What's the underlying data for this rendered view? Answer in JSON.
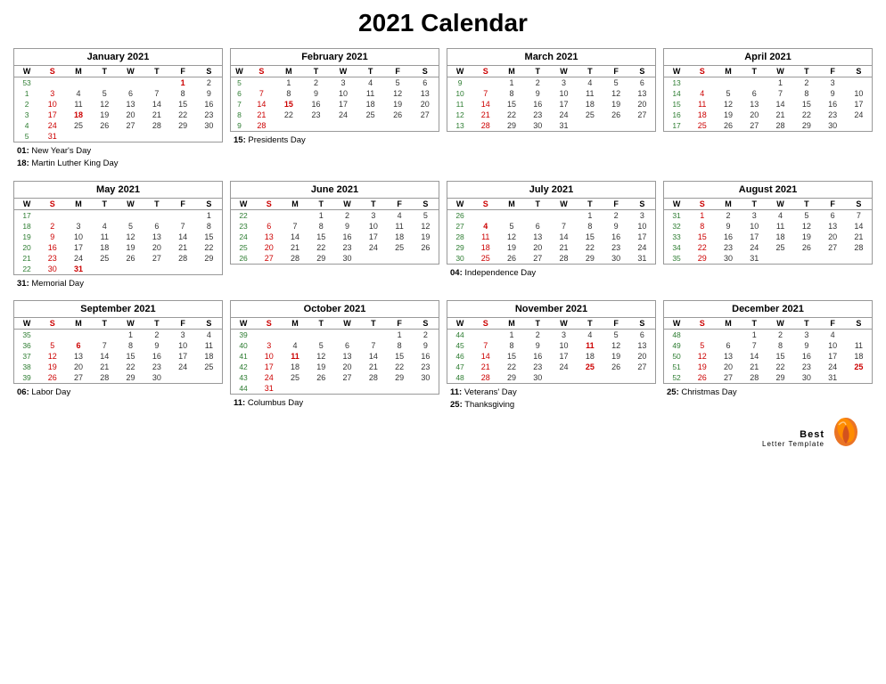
{
  "title": "2021 Calendar",
  "months": [
    {
      "name": "January 2021",
      "headers": [
        "W",
        "S",
        "M",
        "T",
        "W",
        "T",
        "F",
        "S"
      ],
      "rows": [
        [
          "53",
          "",
          "",
          "",
          "",
          "",
          "1",
          "2"
        ],
        [
          "1",
          "3",
          "4",
          "5",
          "6",
          "7",
          "8",
          "9"
        ],
        [
          "2",
          "10",
          "11",
          "12",
          "13",
          "14",
          "15",
          "16"
        ],
        [
          "3",
          "17",
          "18",
          "19",
          "20",
          "21",
          "22",
          "23"
        ],
        [
          "4",
          "24",
          "25",
          "26",
          "27",
          "28",
          "29",
          "30"
        ],
        [
          "5",
          "31",
          "",
          "",
          "",
          "",
          "",
          ""
        ]
      ],
      "holidays_text": "01: New Year's Day\n18: Martin Luther King Day",
      "holidays": [
        {
          "day": "01",
          "name": "New Year's Day"
        },
        {
          "day": "18",
          "name": "Martin Luther King Day"
        }
      ],
      "holiday_days": [
        "1"
      ],
      "holiday_style_days": {
        "1": "holiday",
        "18": "holiday"
      }
    },
    {
      "name": "February 2021",
      "headers": [
        "W",
        "S",
        "M",
        "T",
        "W",
        "T",
        "F",
        "S"
      ],
      "rows": [
        [
          "5",
          "",
          "1",
          "2",
          "3",
          "4",
          "5",
          "6"
        ],
        [
          "6",
          "7",
          "8",
          "9",
          "10",
          "11",
          "12",
          "13"
        ],
        [
          "7",
          "14",
          "15",
          "16",
          "17",
          "18",
          "19",
          "20"
        ],
        [
          "8",
          "21",
          "22",
          "23",
          "24",
          "25",
          "26",
          "27"
        ],
        [
          "9",
          "28",
          "",
          "",
          "",
          "",
          "",
          ""
        ]
      ],
      "holidays": [
        {
          "day": "15",
          "name": "Presidents Day"
        }
      ]
    },
    {
      "name": "March 2021",
      "headers": [
        "W",
        "S",
        "M",
        "T",
        "W",
        "T",
        "F",
        "S"
      ],
      "rows": [
        [
          "9",
          "",
          "1",
          "2",
          "3",
          "4",
          "5",
          "6"
        ],
        [
          "10",
          "7",
          "8",
          "9",
          "10",
          "11",
          "12",
          "13"
        ],
        [
          "11",
          "14",
          "15",
          "16",
          "17",
          "18",
          "19",
          "20"
        ],
        [
          "12",
          "21",
          "22",
          "23",
          "24",
          "25",
          "26",
          "27"
        ],
        [
          "13",
          "28",
          "29",
          "30",
          "31",
          "",
          "",
          ""
        ]
      ],
      "holidays": []
    },
    {
      "name": "April 2021",
      "headers": [
        "W",
        "S",
        "M",
        "T",
        "W",
        "T",
        "F",
        "S"
      ],
      "rows": [
        [
          "13",
          "",
          "",
          "",
          "1",
          "2",
          "3"
        ],
        [
          "14",
          "4",
          "5",
          "6",
          "7",
          "8",
          "9",
          "10"
        ],
        [
          "15",
          "11",
          "12",
          "13",
          "14",
          "15",
          "16",
          "17"
        ],
        [
          "16",
          "18",
          "19",
          "20",
          "21",
          "22",
          "23",
          "24"
        ],
        [
          "17",
          "25",
          "26",
          "27",
          "28",
          "29",
          "30",
          ""
        ]
      ],
      "holidays": []
    },
    {
      "name": "May 2021",
      "headers": [
        "W",
        "S",
        "M",
        "T",
        "W",
        "T",
        "F",
        "S"
      ],
      "rows": [
        [
          "17",
          "",
          "",
          "",
          "",
          "",
          "",
          "1"
        ],
        [
          "18",
          "2",
          "3",
          "4",
          "5",
          "6",
          "7",
          "8"
        ],
        [
          "19",
          "9",
          "10",
          "11",
          "12",
          "13",
          "14",
          "15"
        ],
        [
          "20",
          "16",
          "17",
          "18",
          "19",
          "20",
          "21",
          "22"
        ],
        [
          "21",
          "23",
          "24",
          "25",
          "26",
          "27",
          "28",
          "29"
        ],
        [
          "22",
          "30",
          "31",
          "",
          "",
          "",
          "",
          ""
        ]
      ],
      "holidays": [
        {
          "day": "31",
          "name": "Memorial Day"
        }
      ]
    },
    {
      "name": "June 2021",
      "headers": [
        "W",
        "S",
        "M",
        "T",
        "W",
        "T",
        "F",
        "S"
      ],
      "rows": [
        [
          "22",
          "",
          "",
          "1",
          "2",
          "3",
          "4",
          "5"
        ],
        [
          "23",
          "6",
          "7",
          "8",
          "9",
          "10",
          "11",
          "12"
        ],
        [
          "24",
          "13",
          "14",
          "15",
          "16",
          "17",
          "18",
          "19"
        ],
        [
          "25",
          "20",
          "21",
          "22",
          "23",
          "24",
          "25",
          "26"
        ],
        [
          "26",
          "27",
          "28",
          "29",
          "30",
          "",
          "",
          ""
        ]
      ],
      "holidays": []
    },
    {
      "name": "July 2021",
      "headers": [
        "W",
        "S",
        "M",
        "T",
        "W",
        "T",
        "F",
        "S"
      ],
      "rows": [
        [
          "26",
          "",
          "",
          "",
          "",
          "1",
          "2",
          "3"
        ],
        [
          "27",
          "4",
          "5",
          "6",
          "7",
          "8",
          "9",
          "10"
        ],
        [
          "28",
          "11",
          "12",
          "13",
          "14",
          "15",
          "16",
          "17"
        ],
        [
          "29",
          "18",
          "19",
          "20",
          "21",
          "22",
          "23",
          "24"
        ],
        [
          "30",
          "25",
          "26",
          "27",
          "28",
          "29",
          "30",
          "31"
        ]
      ],
      "holidays": [
        {
          "day": "04",
          "name": "Independence Day"
        }
      ]
    },
    {
      "name": "August 2021",
      "headers": [
        "W",
        "S",
        "M",
        "T",
        "W",
        "T",
        "F",
        "S"
      ],
      "rows": [
        [
          "31",
          "1",
          "2",
          "3",
          "4",
          "5",
          "6",
          "7"
        ],
        [
          "32",
          "8",
          "9",
          "10",
          "11",
          "12",
          "13",
          "14"
        ],
        [
          "33",
          "15",
          "16",
          "17",
          "18",
          "19",
          "20",
          "21"
        ],
        [
          "34",
          "22",
          "23",
          "24",
          "25",
          "26",
          "27",
          "28"
        ],
        [
          "35",
          "29",
          "30",
          "31",
          "",
          "",
          "",
          ""
        ]
      ],
      "holidays": []
    },
    {
      "name": "September 2021",
      "headers": [
        "W",
        "S",
        "M",
        "T",
        "W",
        "T",
        "F",
        "S"
      ],
      "rows": [
        [
          "35",
          "",
          "",
          "",
          "1",
          "2",
          "3",
          "4"
        ],
        [
          "36",
          "5",
          "6",
          "7",
          "8",
          "9",
          "10",
          "11"
        ],
        [
          "37",
          "12",
          "13",
          "14",
          "15",
          "16",
          "17",
          "18"
        ],
        [
          "38",
          "19",
          "20",
          "21",
          "22",
          "23",
          "24",
          "25"
        ],
        [
          "39",
          "26",
          "27",
          "28",
          "29",
          "30",
          "",
          ""
        ]
      ],
      "holidays": [
        {
          "day": "06",
          "name": "Labor Day"
        }
      ]
    },
    {
      "name": "October 2021",
      "headers": [
        "W",
        "S",
        "M",
        "T",
        "W",
        "T",
        "F",
        "S"
      ],
      "rows": [
        [
          "39",
          "",
          "",
          "",
          "",
          "",
          "1",
          "2"
        ],
        [
          "40",
          "3",
          "4",
          "5",
          "6",
          "7",
          "8",
          "9"
        ],
        [
          "41",
          "10",
          "11",
          "12",
          "13",
          "14",
          "15",
          "16"
        ],
        [
          "42",
          "17",
          "18",
          "19",
          "20",
          "21",
          "22",
          "23"
        ],
        [
          "43",
          "24",
          "25",
          "26",
          "27",
          "28",
          "29",
          "30"
        ],
        [
          "44",
          "31",
          "",
          "",
          "",
          "",
          "",
          ""
        ]
      ],
      "holidays": [
        {
          "day": "11",
          "name": "Columbus Day"
        }
      ]
    },
    {
      "name": "November 2021",
      "headers": [
        "W",
        "S",
        "M",
        "T",
        "W",
        "T",
        "F",
        "S"
      ],
      "rows": [
        [
          "44",
          "",
          "1",
          "2",
          "3",
          "4",
          "5",
          "6"
        ],
        [
          "45",
          "7",
          "8",
          "9",
          "10",
          "11",
          "12",
          "13"
        ],
        [
          "46",
          "14",
          "15",
          "16",
          "17",
          "18",
          "19",
          "20"
        ],
        [
          "47",
          "21",
          "22",
          "23",
          "24",
          "25",
          "26",
          "27"
        ],
        [
          "48",
          "28",
          "29",
          "30",
          "",
          "",
          "",
          ""
        ]
      ],
      "holidays": [
        {
          "day": "11",
          "name": "Veterans' Day"
        },
        {
          "day": "25",
          "name": "Thanksgiving"
        }
      ]
    },
    {
      "name": "December 2021",
      "headers": [
        "W",
        "S",
        "M",
        "T",
        "W",
        "T",
        "F",
        "S"
      ],
      "rows": [
        [
          "48",
          "",
          "",
          "1",
          "2",
          "3",
          "4"
        ],
        [
          "49",
          "5",
          "6",
          "7",
          "8",
          "9",
          "10",
          "11"
        ],
        [
          "50",
          "12",
          "13",
          "14",
          "15",
          "16",
          "17",
          "18"
        ],
        [
          "51",
          "19",
          "20",
          "21",
          "22",
          "23",
          "24",
          "25"
        ],
        [
          "52",
          "26",
          "27",
          "28",
          "29",
          "30",
          "31",
          ""
        ]
      ],
      "holidays": [
        {
          "day": "25",
          "name": "Christmas Day"
        }
      ]
    }
  ],
  "holiday_map": {
    "january": {
      "1": true,
      "18": true
    },
    "february": {
      "15": true
    },
    "may": {
      "31": true
    },
    "july": {
      "4": true
    },
    "september": {
      "6": true
    },
    "october": {
      "11": true
    },
    "november": {
      "11": true,
      "25": true
    },
    "december": {
      "25": true
    }
  },
  "logo": {
    "line1": "Best",
    "line2": "Letter Template"
  }
}
